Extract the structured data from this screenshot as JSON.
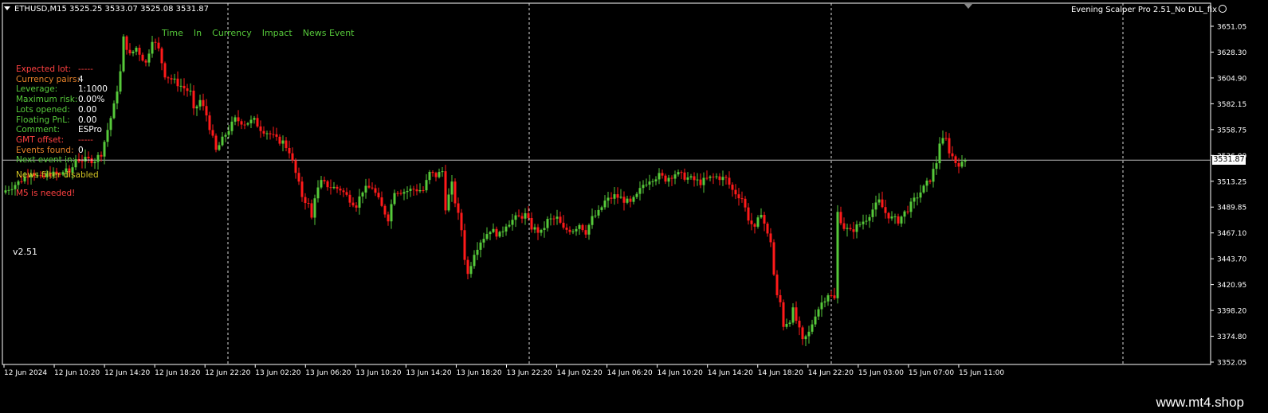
{
  "window": {
    "symbol_info": "ETHUSD,M15  3525.25 3533.07 3525.08 3531.87",
    "ea_name": "Evening Scalper Pro 2.51_No DLL_fix",
    "current_price": "3531.87",
    "current_price_value": 3531.87
  },
  "news_panel": {
    "headers": [
      "Time",
      "In",
      "Currency",
      "Impact",
      "News Event"
    ]
  },
  "info_panel": [
    {
      "label": "Expected lot:",
      "value": "-----",
      "label_color": "red",
      "value_color": "red"
    },
    {
      "label": "Currency pairs:",
      "value": "4",
      "label_color": "orange",
      "value_color": "white"
    },
    {
      "label": "Leverage:",
      "value": "1:1000",
      "label_color": "green",
      "value_color": "white"
    },
    {
      "label": "Maximum risk:",
      "value": "0.00%",
      "label_color": "green",
      "value_color": "white"
    },
    {
      "label": "Lots opened:",
      "value": "0.00",
      "label_color": "green",
      "value_color": "white"
    },
    {
      "label": "Floating PnL:",
      "value": "0.00",
      "label_color": "green",
      "value_color": "white"
    },
    {
      "label": "Comment:",
      "value": "ESPro",
      "label_color": "green",
      "value_color": "white"
    },
    {
      "label": "GMT offset:",
      "value": "-----",
      "label_color": "red",
      "value_color": "red"
    },
    {
      "label": "Events found:",
      "value": "0",
      "label_color": "orange",
      "value_color": "white"
    },
    {
      "label": "Next event in:",
      "value": "-----",
      "label_color": "green",
      "value_color": "white"
    }
  ],
  "messages": {
    "news_filter": "News filter disabled",
    "m5_needed": "M5 is needed!",
    "version": "v2.51"
  },
  "watermark": "www.mt4.shop",
  "colors": {
    "background": "#000000",
    "bull": "#56c93a",
    "bear": "#ff1a1a",
    "grid": "#ffffff",
    "text": "#ffffff"
  },
  "chart_data": {
    "type": "candlestick",
    "ylim": [
      3352.05,
      3661.0
    ],
    "y_ticks": [
      "3651.05",
      "3628.30",
      "3604.90",
      "3582.15",
      "3558.75",
      "3536.00",
      "3513.25",
      "3489.85",
      "3467.10",
      "3443.70",
      "3420.95",
      "3398.20",
      "3374.80",
      "3352.05"
    ],
    "x_ticks": [
      "12 Jun 2024",
      "12 Jun 10:20",
      "12 Jun 14:20",
      "12 Jun 18:20",
      "12 Jun 22:20",
      "13 Jun 02:20",
      "13 Jun 06:20",
      "13 Jun 10:20",
      "13 Jun 14:20",
      "13 Jun 18:20",
      "13 Jun 22:20",
      "14 Jun 02:20",
      "14 Jun 06:20",
      "14 Jun 10:20",
      "14 Jun 14:20",
      "14 Jun 18:20",
      "14 Jun 22:20",
      "15 Jun 03:00",
      "15 Jun 07:00",
      "15 Jun 11:00"
    ],
    "day_separators": [
      "13 Jun",
      "14 Jun",
      "15 Jun",
      "16 Jun"
    ],
    "anchors": [
      [
        0,
        3505
      ],
      [
        4,
        3512
      ],
      [
        8,
        3522
      ],
      [
        11,
        3515
      ],
      [
        14,
        3520
      ],
      [
        17,
        3518
      ],
      [
        19,
        3525
      ],
      [
        20,
        3518
      ],
      [
        22,
        3533
      ],
      [
        24,
        3532
      ],
      [
        28,
        3532
      ],
      [
        30,
        3538
      ],
      [
        34,
        3580
      ],
      [
        36,
        3610
      ],
      [
        37,
        3640
      ],
      [
        39,
        3625
      ],
      [
        41,
        3632
      ],
      [
        44,
        3618
      ],
      [
        46,
        3640
      ],
      [
        48,
        3630
      ],
      [
        50,
        3608
      ],
      [
        55,
        3598
      ],
      [
        58,
        3592
      ],
      [
        59,
        3575
      ],
      [
        61,
        3585
      ],
      [
        63,
        3572
      ],
      [
        66,
        3540
      ],
      [
        69,
        3555
      ],
      [
        72,
        3568
      ],
      [
        75,
        3565
      ],
      [
        78,
        3567
      ],
      [
        80,
        3560
      ],
      [
        83,
        3555
      ],
      [
        85,
        3550
      ],
      [
        87,
        3548
      ],
      [
        89,
        3540
      ],
      [
        91,
        3520
      ],
      [
        93,
        3500
      ],
      [
        95,
        3492
      ],
      [
        96,
        3480
      ],
      [
        97,
        3500
      ],
      [
        99,
        3512
      ],
      [
        102,
        3508
      ],
      [
        105,
        3506
      ],
      [
        108,
        3497
      ],
      [
        110,
        3492
      ],
      [
        112,
        3505
      ],
      [
        115,
        3508
      ],
      [
        118,
        3490
      ],
      [
        120,
        3480
      ],
      [
        122,
        3505
      ],
      [
        125,
        3504
      ],
      [
        128,
        3506
      ],
      [
        131,
        3505
      ],
      [
        133,
        3520
      ],
      [
        135,
        3518
      ],
      [
        137,
        3522
      ],
      [
        138,
        3490
      ],
      [
        140,
        3510
      ],
      [
        141,
        3495
      ],
      [
        143,
        3470
      ],
      [
        144,
        3445
      ],
      [
        145,
        3430
      ],
      [
        147,
        3450
      ],
      [
        149,
        3460
      ],
      [
        152,
        3470
      ],
      [
        155,
        3465
      ],
      [
        157,
        3475
      ],
      [
        160,
        3480
      ],
      [
        163,
        3483
      ],
      [
        165,
        3472
      ],
      [
        168,
        3467
      ],
      [
        170,
        3478
      ],
      [
        173,
        3480
      ],
      [
        175,
        3470
      ],
      [
        178,
        3470
      ],
      [
        180,
        3475
      ],
      [
        182,
        3468
      ],
      [
        184,
        3480
      ],
      [
        186,
        3485
      ],
      [
        188,
        3495
      ],
      [
        191,
        3500
      ],
      [
        193,
        3498
      ],
      [
        196,
        3493
      ],
      [
        198,
        3500
      ],
      [
        200,
        3510
      ],
      [
        202,
        3515
      ],
      [
        205,
        3518
      ],
      [
        207,
        3515
      ],
      [
        210,
        3520
      ],
      [
        212,
        3518
      ],
      [
        215,
        3515
      ],
      [
        218,
        3512
      ],
      [
        220,
        3515
      ],
      [
        223,
        3517
      ],
      [
        226,
        3515
      ],
      [
        228,
        3505
      ],
      [
        231,
        3498
      ],
      [
        233,
        3480
      ],
      [
        235,
        3470
      ],
      [
        237,
        3486
      ],
      [
        239,
        3465
      ],
      [
        240,
        3460
      ],
      [
        241,
        3430
      ],
      [
        242,
        3410
      ],
      [
        243,
        3405
      ],
      [
        244,
        3385
      ],
      [
        246,
        3390
      ],
      [
        247,
        3398
      ],
      [
        249,
        3380
      ],
      [
        250,
        3370
      ],
      [
        252,
        3378
      ],
      [
        254,
        3395
      ],
      [
        256,
        3405
      ],
      [
        258,
        3413
      ],
      [
        260,
        3408
      ],
      [
        261,
        3485
      ],
      [
        263,
        3472
      ],
      [
        265,
        3468
      ],
      [
        268,
        3475
      ],
      [
        270,
        3480
      ],
      [
        272,
        3488
      ],
      [
        274,
        3495
      ],
      [
        276,
        3485
      ],
      [
        278,
        3480
      ],
      [
        280,
        3478
      ],
      [
        282,
        3485
      ],
      [
        284,
        3492
      ],
      [
        286,
        3500
      ],
      [
        288,
        3507
      ],
      [
        290,
        3515
      ],
      [
        292,
        3530
      ],
      [
        293,
        3548
      ],
      [
        295,
        3550
      ],
      [
        296,
        3540
      ],
      [
        298,
        3530
      ],
      [
        300,
        3528
      ],
      [
        301,
        3531.87
      ]
    ]
  }
}
